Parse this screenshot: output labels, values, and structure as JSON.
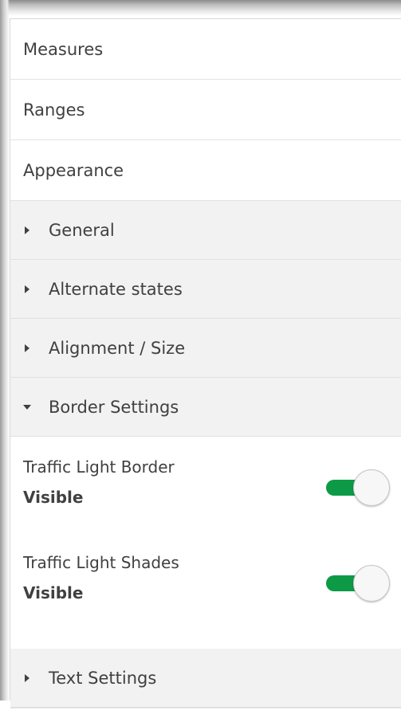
{
  "sections": [
    {
      "label": "Measures"
    },
    {
      "label": "Ranges"
    },
    {
      "label": "Appearance"
    }
  ],
  "appearance_accordion": {
    "items": [
      {
        "label": "General",
        "expanded": false
      },
      {
        "label": "Alternate states",
        "expanded": false
      },
      {
        "label": "Alignment / Size",
        "expanded": false
      },
      {
        "label": "Border Settings",
        "expanded": true
      }
    ],
    "border_settings": {
      "toggles": [
        {
          "label": "Traffic Light Border",
          "state": "Visible",
          "on": true
        },
        {
          "label": "Traffic Light Shades",
          "state": "Visible",
          "on": true
        }
      ]
    },
    "after_items": [
      {
        "label": "Text Settings",
        "expanded": false
      }
    ]
  },
  "colors": {
    "toggle_on": "#0c9a46",
    "accordion_bg": "#f2f2f2",
    "text": "#404040"
  }
}
